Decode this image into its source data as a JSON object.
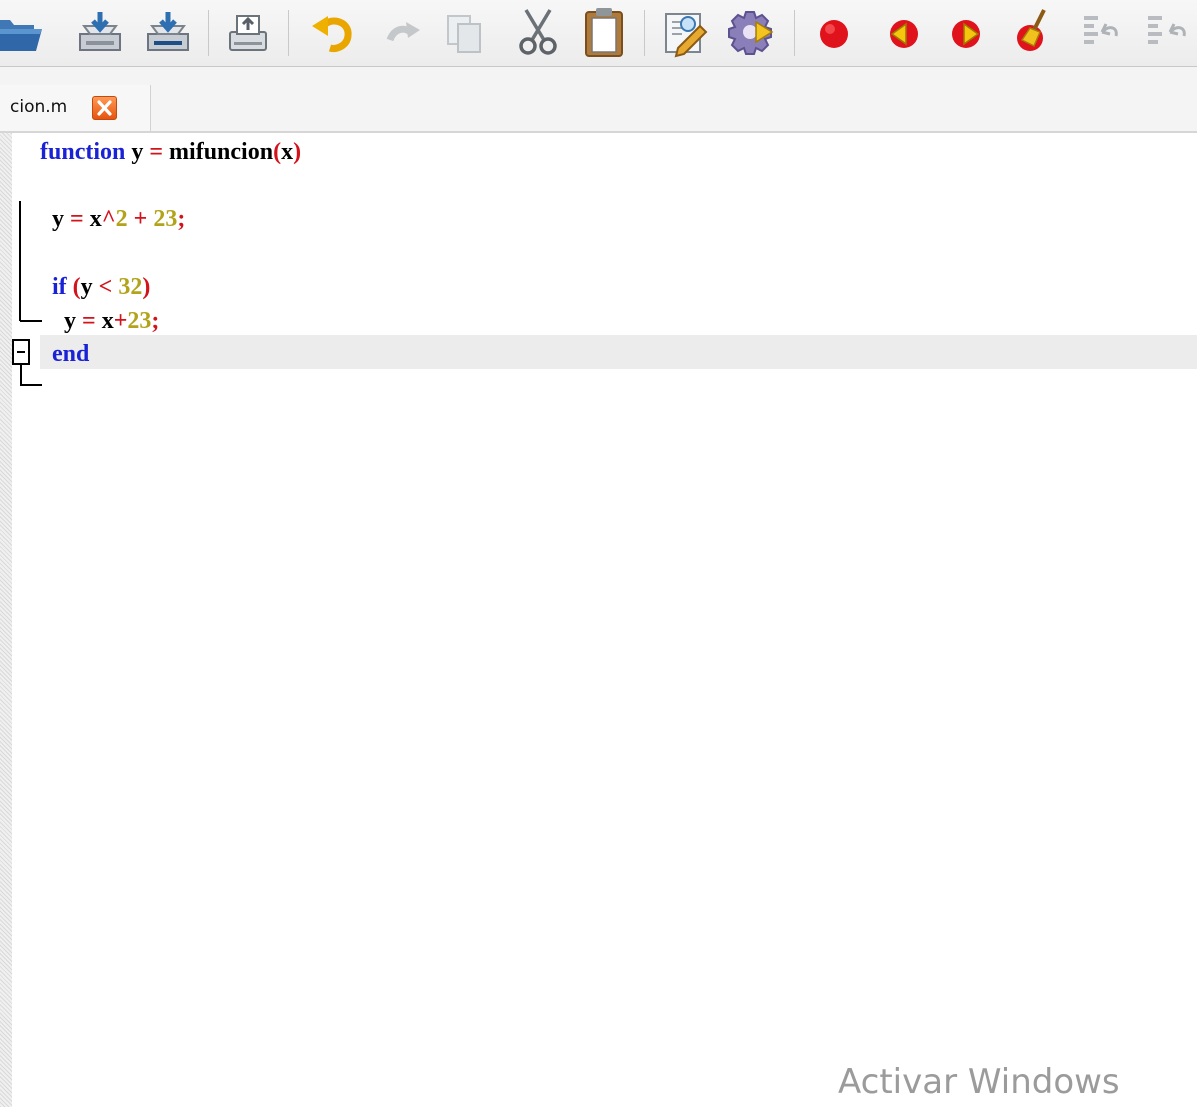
{
  "toolbar": {
    "buttons": [
      {
        "name": "open-folder-icon"
      },
      {
        "name": "save-icon"
      },
      {
        "name": "save-as-icon"
      },
      {
        "name": "print-icon"
      },
      {
        "name": "undo-icon"
      },
      {
        "name": "redo-icon"
      },
      {
        "name": "copy-icon"
      },
      {
        "name": "cut-icon"
      },
      {
        "name": "paste-icon"
      },
      {
        "name": "edit-icon"
      },
      {
        "name": "settings-icon"
      },
      {
        "name": "breakpoint-icon"
      },
      {
        "name": "previous-breakpoint-icon"
      },
      {
        "name": "next-breakpoint-icon"
      },
      {
        "name": "clear-breakpoints-icon"
      },
      {
        "name": "comment-icon"
      },
      {
        "name": "uncomment-icon"
      }
    ]
  },
  "tab": {
    "label": "cion.m",
    "close_icon": "close-icon"
  },
  "code": {
    "lines": [
      [
        {
          "t": "function",
          "c": "kw"
        },
        {
          "t": " y ",
          "c": "id"
        },
        {
          "t": "=",
          "c": "op"
        },
        {
          "t": " mifuncion",
          "c": "id"
        },
        {
          "t": "(",
          "c": "op"
        },
        {
          "t": "x",
          "c": "id"
        },
        {
          "t": ")",
          "c": "op"
        }
      ],
      [],
      [
        {
          "t": "  y ",
          "c": "id"
        },
        {
          "t": "=",
          "c": "op"
        },
        {
          "t": " x",
          "c": "id"
        },
        {
          "t": "^",
          "c": "op"
        },
        {
          "t": "2",
          "c": "num"
        },
        {
          "t": " + ",
          "c": "op"
        },
        {
          "t": "23",
          "c": "num"
        },
        {
          "t": ";",
          "c": "op"
        }
      ],
      [],
      [
        {
          "t": "  if ",
          "c": "kw"
        },
        {
          "t": "(",
          "c": "op"
        },
        {
          "t": "y ",
          "c": "id"
        },
        {
          "t": "<",
          "c": "op"
        },
        {
          "t": " ",
          "c": "id"
        },
        {
          "t": "32",
          "c": "num"
        },
        {
          "t": ")",
          "c": "op"
        }
      ],
      [
        {
          "t": "    y ",
          "c": "id"
        },
        {
          "t": "=",
          "c": "op"
        },
        {
          "t": " x",
          "c": "id"
        },
        {
          "t": "+",
          "c": "op"
        },
        {
          "t": "23",
          "c": "num"
        },
        {
          "t": ";",
          "c": "op"
        }
      ],
      [
        {
          "t": "  end",
          "c": "kw"
        }
      ]
    ],
    "current_line": 7
  },
  "watermark": "Activar Windows",
  "colors": {
    "keyword": "#1a22d6",
    "operator": "#d4121a",
    "number": "#b3a31a",
    "current_line_bg": "#ececec"
  }
}
